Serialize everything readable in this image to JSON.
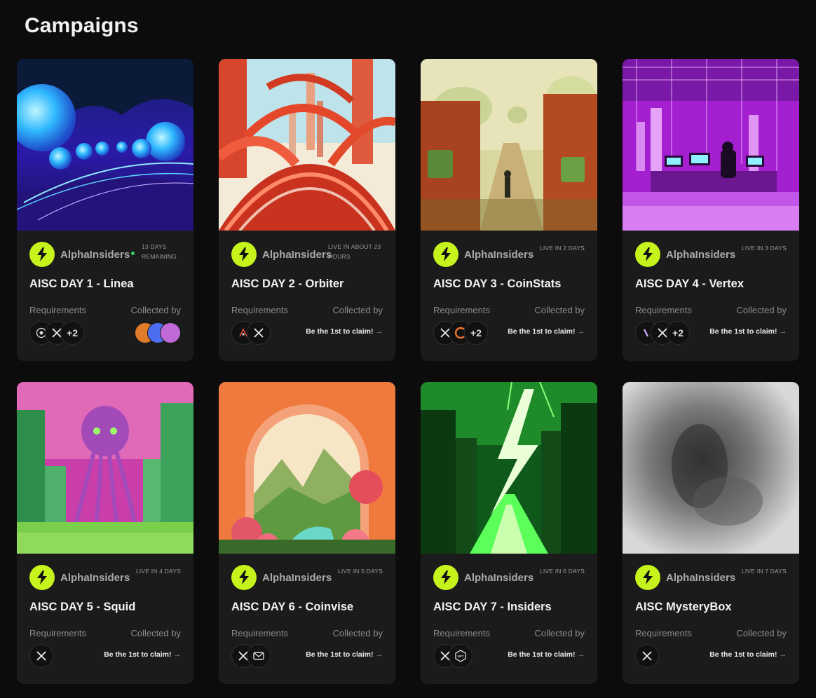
{
  "page": {
    "title": "Campaigns"
  },
  "labels": {
    "requirements": "Requirements",
    "collected_by": "Collected by"
  },
  "colors": {
    "accent": "#c6f31c",
    "card_bg": "#1b1b1b",
    "page_bg": "#0c0c0c"
  },
  "cards": [
    {
      "brand": "AlphaInsiders",
      "status": "13 DAYS REMAINING",
      "title": "AISC DAY 1 - Linea",
      "requirements": [
        "target-icon",
        "x-icon"
      ],
      "extra": "+2",
      "collected": "avatars",
      "claim": ""
    },
    {
      "brand": "AlphaInsiders",
      "status": "LIVE IN ABOUT 23 HOURS",
      "title": "AISC DAY 2 - Orbiter",
      "requirements": [
        "orbiter-icon",
        "x-icon"
      ],
      "extra": "",
      "collected": "claim",
      "claim": "Be the 1st to claim!"
    },
    {
      "brand": "AlphaInsiders",
      "status": "LIVE IN 2 DAYS",
      "title": "AISC DAY 3 - CoinStats",
      "requirements": [
        "x-icon",
        "coinstats-icon"
      ],
      "extra": "+2",
      "collected": "claim",
      "claim": "Be the 1st to claim!"
    },
    {
      "brand": "AlphaInsiders",
      "status": "LIVE IN 3 DAYS",
      "title": "AISC DAY 4 - Vertex",
      "requirements": [
        "vertex-icon",
        "x-icon"
      ],
      "extra": "+2",
      "collected": "claim",
      "claim": "Be the 1st to claim!"
    },
    {
      "brand": "AlphaInsiders",
      "status": "LIVE IN 4 DAYS",
      "title": "AISC DAY 5 - Squid",
      "requirements": [
        "x-icon"
      ],
      "extra": "",
      "collected": "claim",
      "claim": "Be the 1st to claim!"
    },
    {
      "brand": "AlphaInsiders",
      "status": "LIVE IN 5 DAYS",
      "title": "AISC DAY 6 - Coinvise",
      "requirements": [
        "x-icon",
        "mail-icon"
      ],
      "extra": "",
      "collected": "claim",
      "claim": "Be the 1st to claim!"
    },
    {
      "brand": "AlphaInsiders",
      "status": "LIVE IN 6 DAYS",
      "title": "AISC DAY 7 - Insiders",
      "requirements": [
        "x-icon",
        "nft-icon"
      ],
      "extra": "",
      "collected": "claim",
      "claim": "Be the 1st to claim!"
    },
    {
      "brand": "AlphaInsiders",
      "status": "LIVE IN 7 DAYS",
      "title": "AISC MysteryBox",
      "requirements": [
        "x-icon"
      ],
      "extra": "",
      "collected": "claim",
      "claim": "Be the 1st to claim!"
    }
  ],
  "nft_badge_text": "NFT",
  "arrow": "→"
}
